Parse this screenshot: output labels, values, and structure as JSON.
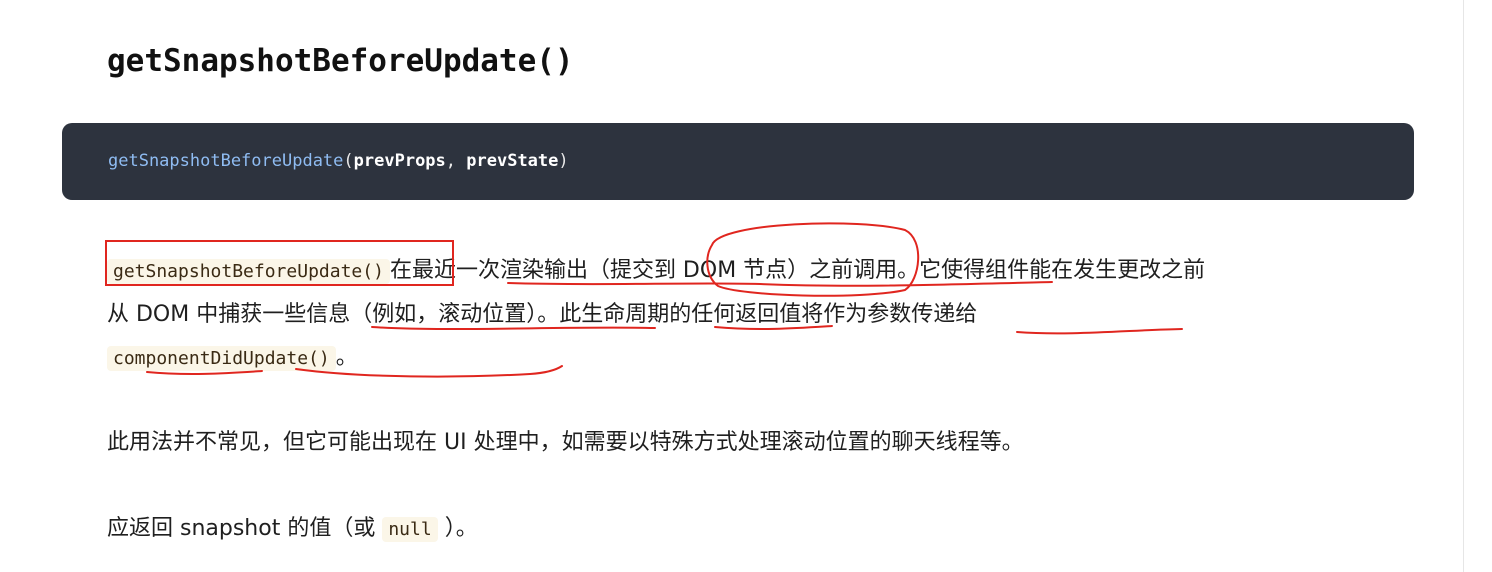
{
  "doc": {
    "heading": "getSnapshotBeforeUpdate()",
    "code_signature": {
      "fn": "getSnapshotBeforeUpdate",
      "open": "(",
      "param1": "prevProps",
      "sep": ", ",
      "param2": "prevState",
      "close": ")"
    },
    "p1": {
      "code1": "getSnapshotBeforeUpdate()",
      "text1": "在最近一次渲染输出（提交到 DOM 节点）之前调用。它使得组件能在发生更改之前从 DOM 中捕获一些信息（例如，滚动位置）。此生命周期的任何返回值将作为参数传递给",
      "code2": "componentDidUpdate()",
      "text2": "。"
    },
    "p2": "此用法并不常见，但它可能出现在 UI 处理中，如需要以特殊方式处理滚动位置的聊天线程等。",
    "p3": {
      "text1": "应返回 snapshot 的值（或",
      "code": "null",
      "text2": "）。"
    }
  },
  "annotation_colors": {
    "pen": "#e0261f"
  }
}
